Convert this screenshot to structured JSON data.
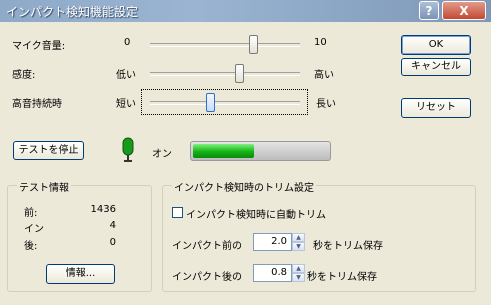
{
  "window": {
    "title": "インパクト検知機能設定",
    "help_label": "?",
    "close_label": "X"
  },
  "sliders": [
    {
      "label": "マイク音量:",
      "min_label": "0",
      "max_label": "10",
      "value": 0.7
    },
    {
      "label": "感度:",
      "min_label": "低い",
      "max_label": "高い",
      "value": 0.6
    },
    {
      "label": "高音持続時",
      "min_label": "短い",
      "max_label": "長い",
      "value": 0.4
    }
  ],
  "buttons": {
    "ok": "OK",
    "cancel": "キャンセル",
    "reset": "リセット",
    "stop_test": "テストを停止",
    "info": "情報..."
  },
  "test_status": {
    "indicator_label": "オン",
    "level": 0.45,
    "indicator_color": "#1a9a1a"
  },
  "test_info": {
    "title": "テスト情報",
    "rows": [
      {
        "label": "前:",
        "value": "1436"
      },
      {
        "label": "イン",
        "value": "4"
      },
      {
        "label": "後:",
        "value": "0"
      }
    ]
  },
  "trim": {
    "title": "インパクト検知時のトリム設定",
    "auto_trim_label": "インパクト検知時に自動トリム",
    "auto_trim_checked": false,
    "before_label": "インパクト前の",
    "before_value": "2.0",
    "before_suffix": "秒をトリム保存",
    "after_label": "インパクト後の",
    "after_value": "0.8",
    "after_suffix": "秒をトリム保存"
  }
}
